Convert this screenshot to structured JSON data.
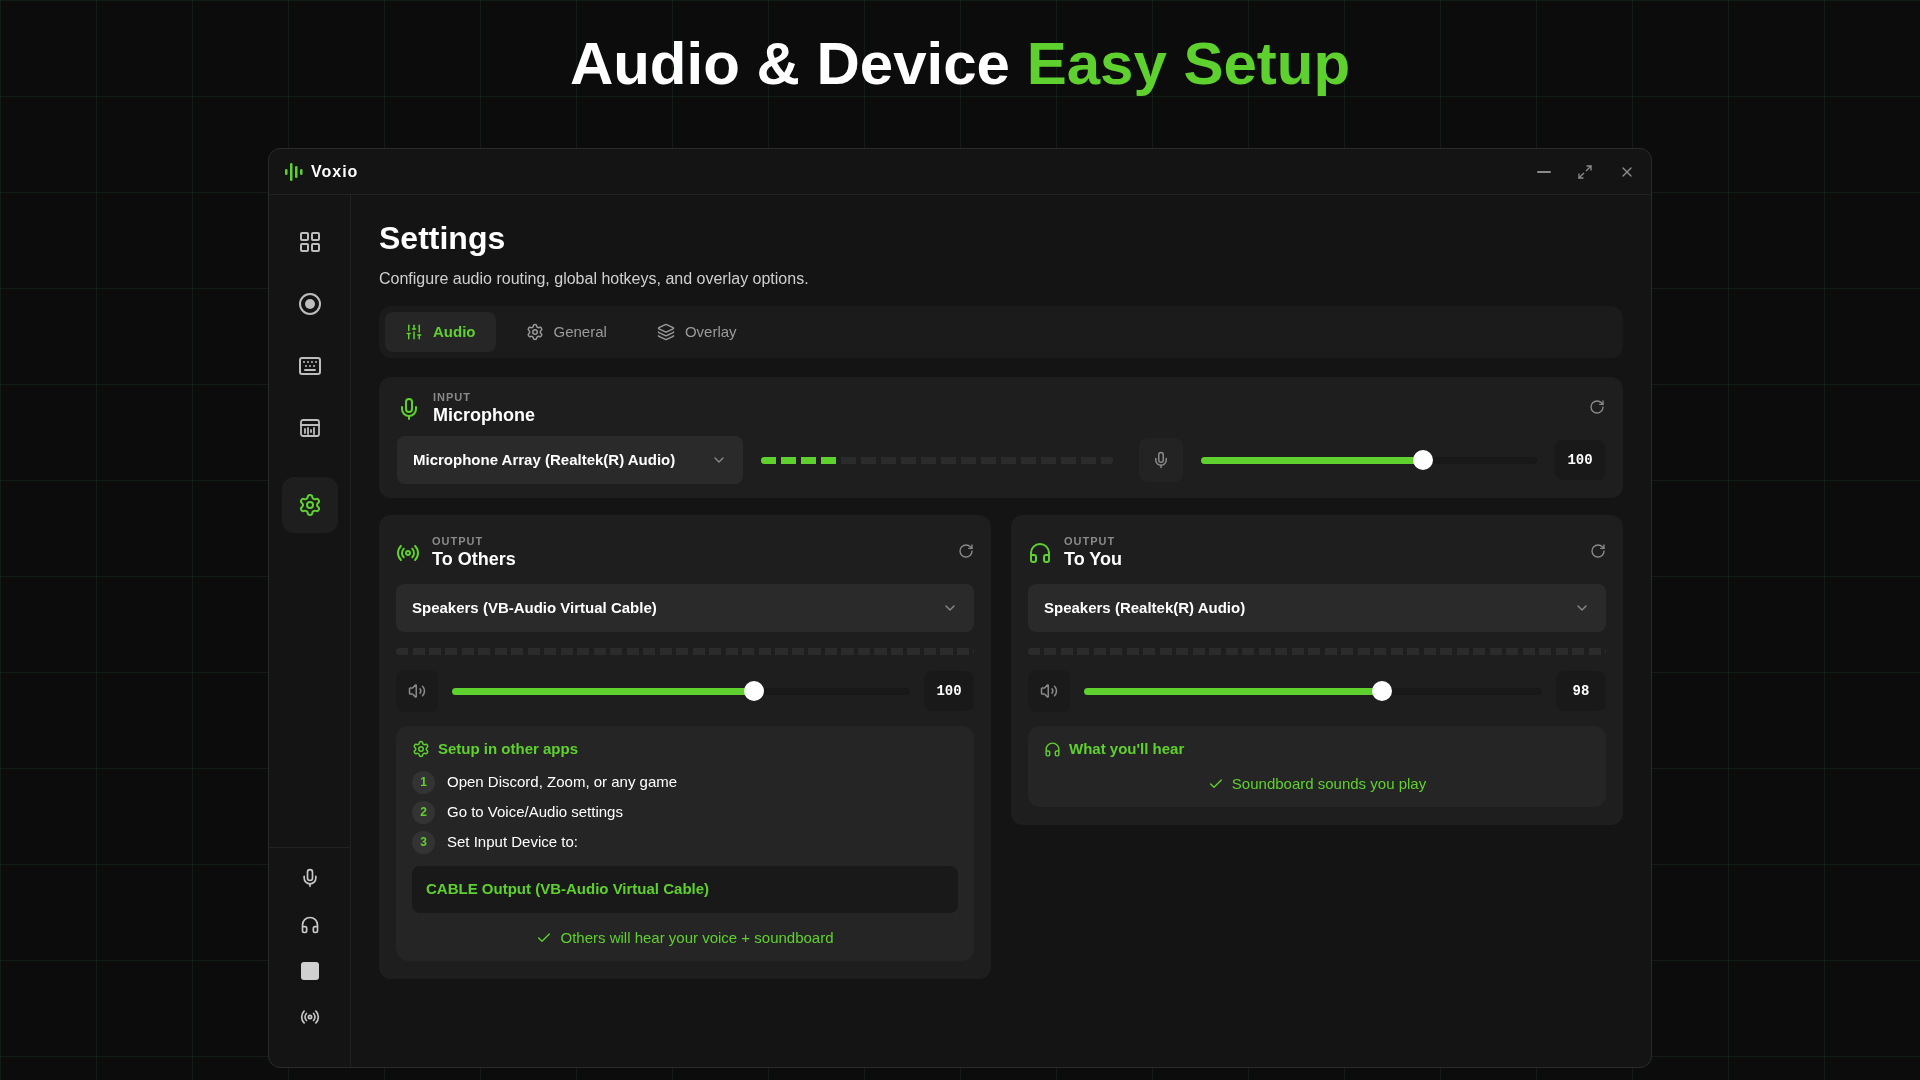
{
  "headline": {
    "text": "Audio & Device",
    "highlight": "Easy Setup"
  },
  "window": {
    "title": "Voxio"
  },
  "sidebar": {
    "items": [
      {
        "selected": false
      },
      {
        "selected": false
      },
      {
        "selected": false
      },
      {
        "selected": false
      },
      {
        "selected": true
      }
    ],
    "status_items": [
      {
        "kind": "mic"
      },
      {
        "kind": "headphones"
      },
      {
        "kind": "stop"
      },
      {
        "kind": "broadcast"
      }
    ]
  },
  "page": {
    "title": "Settings",
    "subtitle": "Configure audio routing, global hotkeys, and overlay options."
  },
  "tabs": [
    {
      "label": "Audio",
      "selected": true
    },
    {
      "label": "General",
      "selected": false
    },
    {
      "label": "Overlay",
      "selected": false
    }
  ],
  "input": {
    "eyebrow": "INPUT",
    "title": "Microphone",
    "device": "Microphone Array (Realtek(R) Audio)",
    "meter": {
      "level": 0.22
    },
    "volume": {
      "level": 0.66,
      "reading": "100"
    }
  },
  "outputs": [
    {
      "kind": "others",
      "eyebrow": "OUTPUT",
      "title": "To Others",
      "device": "Speakers (VB-Audio Virtual Cable)",
      "volume": {
        "level": 0.66,
        "reading": "100"
      },
      "info": {
        "kind": "steps",
        "title": "Setup in other apps",
        "steps": [
          {
            "number": "1",
            "text": "Open Discord, Zoom, or any game"
          },
          {
            "number": "2",
            "text": "Go to Voice/Audio settings"
          },
          {
            "number": "3",
            "text": "Set Input Device to:"
          }
        ],
        "device": "CABLE Output (VB-Audio Virtual Cable)",
        "note": "Others will hear your voice + soundboard"
      }
    },
    {
      "kind": "you",
      "eyebrow": "OUTPUT",
      "title": "To You",
      "device": "Speakers (Realtek(R) Audio)",
      "volume": {
        "level": 0.65,
        "reading": "98"
      },
      "info": {
        "kind": "hear",
        "title": "What you'll hear",
        "note": "Soundboard sounds you play"
      }
    }
  ]
}
